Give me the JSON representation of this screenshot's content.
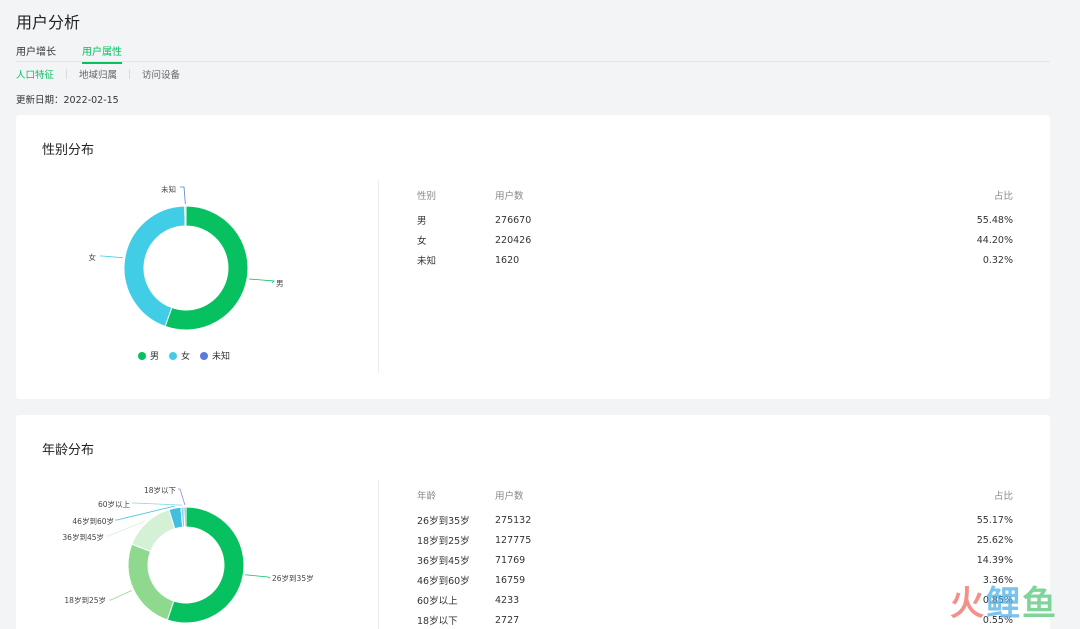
{
  "page": {
    "title": "用户分析"
  },
  "tabs": [
    {
      "label": "用户增长",
      "active": false
    },
    {
      "label": "用户属性",
      "active": true
    }
  ],
  "subtabs": [
    {
      "label": "人口特征",
      "active": true
    },
    {
      "label": "地域归属",
      "active": false
    },
    {
      "label": "访问设备",
      "active": false
    }
  ],
  "update": {
    "label": "更新日期：",
    "date": "2022-02-15"
  },
  "gender": {
    "title": "性别分布",
    "headers": {
      "col1": "性别",
      "col2": "用户数",
      "col3": "占比"
    },
    "rows": [
      {
        "name": "男",
        "count": "276670",
        "pct": "55.48%"
      },
      {
        "name": "女",
        "count": "220426",
        "pct": "44.20%"
      },
      {
        "name": "未知",
        "count": "1620",
        "pct": "0.32%"
      }
    ],
    "legend": [
      "男",
      "女",
      "未知"
    ]
  },
  "age": {
    "title": "年龄分布",
    "headers": {
      "col1": "年龄",
      "col2": "用户数",
      "col3": "占比"
    },
    "rows": [
      {
        "name": "26岁到35岁",
        "count": "275132",
        "pct": "55.17%"
      },
      {
        "name": "18岁到25岁",
        "count": "127775",
        "pct": "25.62%"
      },
      {
        "name": "36岁到45岁",
        "count": "71769",
        "pct": "14.39%"
      },
      {
        "name": "46岁到60岁",
        "count": "16759",
        "pct": "3.36%"
      },
      {
        "name": "60岁以上",
        "count": "4233",
        "pct": "0.85%"
      },
      {
        "name": "18岁以下",
        "count": "2727",
        "pct": "0.55%"
      }
    ]
  },
  "chart_data": [
    {
      "type": "pie",
      "title": "性别分布",
      "categories": [
        "男",
        "女",
        "未知"
      ],
      "values": [
        55.48,
        44.2,
        0.32
      ],
      "colors": [
        "#07c160",
        "#41cde5",
        "#5b7be0"
      ],
      "donut": true,
      "legend": "bottom"
    },
    {
      "type": "pie",
      "title": "年龄分布",
      "categories": [
        "26岁到35岁",
        "18岁到25岁",
        "36岁到45岁",
        "46岁到60岁",
        "60岁以上",
        "18岁以下"
      ],
      "values": [
        55.17,
        25.62,
        14.39,
        3.36,
        0.85,
        0.55
      ],
      "colors": [
        "#07c160",
        "#8fd98f",
        "#d4f1d6",
        "#41bfe0",
        "#7fd8e8",
        "#8a8fdb"
      ],
      "donut": true
    }
  ],
  "watermark": {
    "c1": "火",
    "c2": "鲤",
    "c3": "鱼"
  }
}
